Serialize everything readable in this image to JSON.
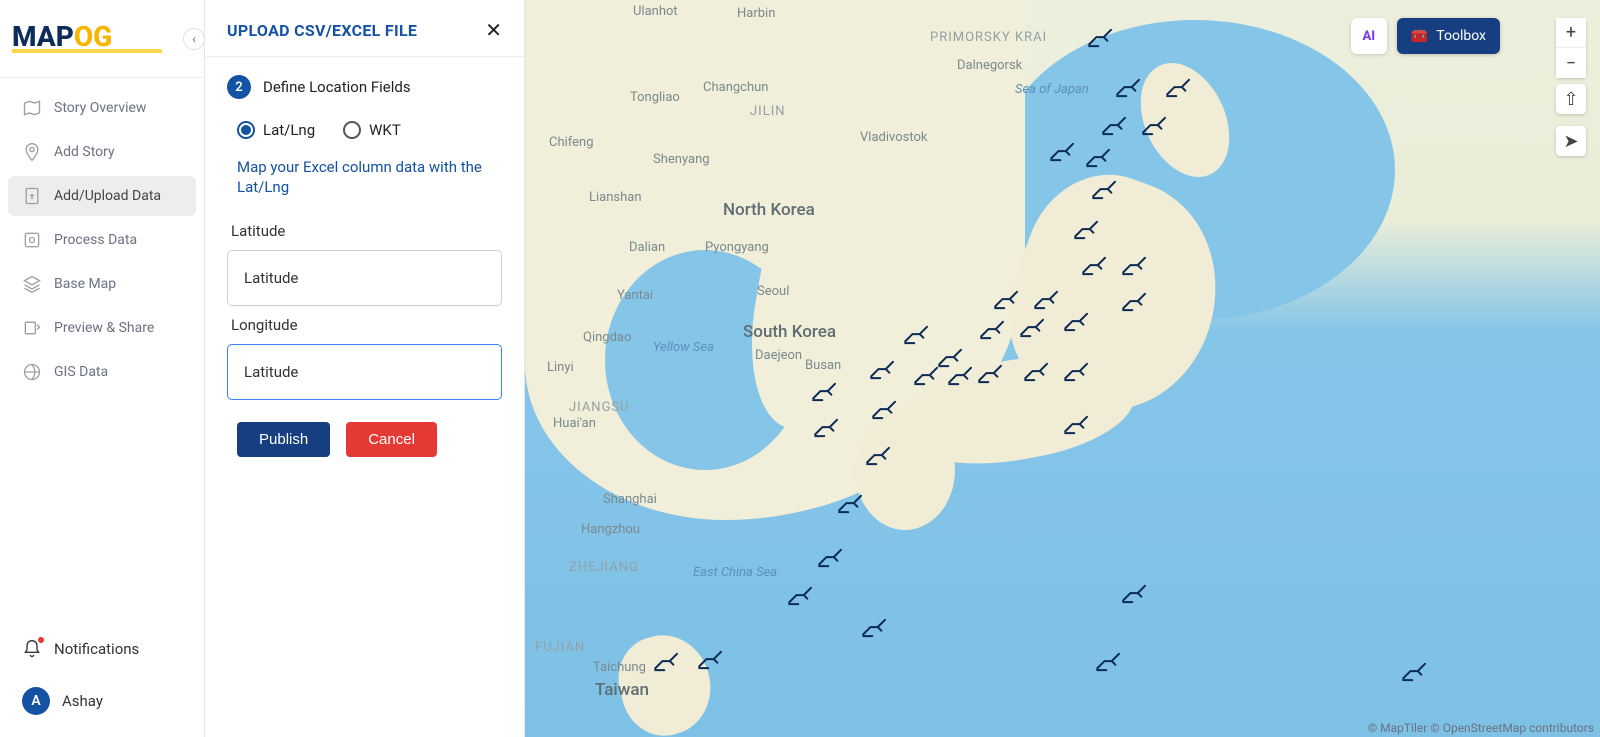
{
  "logo": {
    "part1": "MAP",
    "part2": "OG"
  },
  "sidebar": {
    "items": [
      {
        "label": "Story Overview",
        "icon": "map-icon"
      },
      {
        "label": "Add Story",
        "icon": "pin-plus-icon"
      },
      {
        "label": "Add/Upload Data",
        "icon": "upload-file-icon",
        "active": true
      },
      {
        "label": "Process Data",
        "icon": "gear-box-icon"
      },
      {
        "label": "Base Map",
        "icon": "layers-icon"
      },
      {
        "label": "Preview & Share",
        "icon": "share-icon"
      },
      {
        "label": "GIS Data",
        "icon": "globe-pin-icon"
      }
    ],
    "notifications_label": "Notifications",
    "user": {
      "initial": "A",
      "name": "Ashay"
    }
  },
  "upload": {
    "title": "UPLOAD CSV/EXCEL FILE",
    "step_number": "2",
    "step_label": "Define Location Fields",
    "radio_latlng": "Lat/Lng",
    "radio_wkt": "WKT",
    "hint": "Map your Excel column data with the Lat/Lng",
    "latitude_label": "Latitude",
    "latitude_value": "Latitude",
    "longitude_label": "Longitude",
    "longitude_value": "Latitude",
    "publish_label": "Publish",
    "cancel_label": "Cancel"
  },
  "map": {
    "labels": {
      "ulanhot": "Ulanhot",
      "harbin": "Harbin",
      "primorsky": "PRIMORSKY KRAI",
      "changchun": "Changchun",
      "tongliao": "Tongliao",
      "jilin": "JILIN",
      "vladivostok": "Vladivostok",
      "dalnegorsk": "Dalnegorsk",
      "chifeng": "Chifeng",
      "shenyang": "Shenyang",
      "sea_of_japan": "Sea of Japan",
      "lianshan": "Lianshan",
      "north_korea": "North Korea",
      "dalian": "Dalian",
      "pyongyang": "Pyongyang",
      "yantai": "Yantai",
      "seoul": "Seoul",
      "qingdao": "Qingdao",
      "south_korea": "South Korea",
      "yellow_sea": "Yellow Sea",
      "daejeon": "Daejeon",
      "linyi": "Linyi",
      "busan": "Busan",
      "jiangsu": "JIANGSU",
      "huaian": "Huai'an",
      "shanghai": "Shanghai",
      "hangzhou": "Hangzhou",
      "zhejiang": "ZHEJIANG",
      "east_china_sea": "East China Sea",
      "fujian": "FUJIAN",
      "taiwan": "Taiwan",
      "taichung": "Taichung"
    },
    "toolbox_label": "Toolbox",
    "ai_label": "AI",
    "attribution": "© MapTiler © OpenStreetMap contributors"
  }
}
